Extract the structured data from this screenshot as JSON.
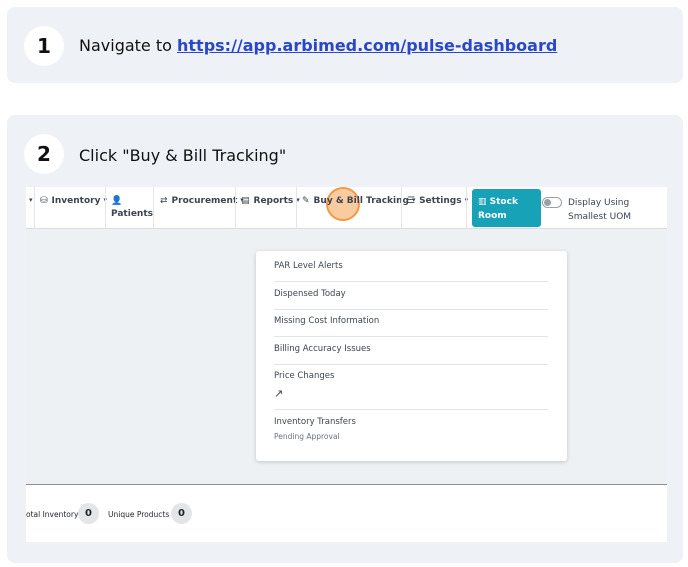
{
  "steps": [
    {
      "number": "1",
      "text_prefix": "Navigate to ",
      "link": "https://app.arbimed.com/pulse-dashboard"
    },
    {
      "number": "2",
      "text": "Click \"Buy & Bill Tracking\""
    }
  ],
  "navbar": {
    "inventory": "Inventory",
    "patients": "Patients",
    "procurement": "Procurement",
    "reports": "Reports",
    "buy_bill": "Buy & Bill Tracking",
    "settings": "Settings",
    "stock_room_line1": "Stock",
    "stock_room_line2": "Room",
    "display_toggle": "Display Using Smallest UOM"
  },
  "dropdown": {
    "items": [
      {
        "label": "PAR Level Alerts"
      },
      {
        "label": "Dispensed Today"
      },
      {
        "label": "Missing Cost Information"
      },
      {
        "label": "Billing Accuracy Issues"
      },
      {
        "label": "Price Changes"
      },
      {
        "label": "Inventory Transfers",
        "sub": "Pending Approval"
      }
    ]
  },
  "stats": {
    "total_inventory_label": "otal Inventory",
    "total_inventory_value": "0",
    "unique_products_label": "Unique Products",
    "unique_products_value": "0"
  },
  "icons": {
    "inventory": "cubes-icon",
    "patients": "user-icon",
    "procurement": "exchange-icon",
    "reports": "file-icon",
    "buy_bill": "pen-icon",
    "settings": "sliders-icon",
    "stock_room": "barcode-icon",
    "trend": "trend-up-icon"
  },
  "colors": {
    "link": "#2a47c7",
    "stock_room_button": "#17a2b8",
    "click_marker": "#f4a350",
    "card_background": "#eef2f7"
  }
}
